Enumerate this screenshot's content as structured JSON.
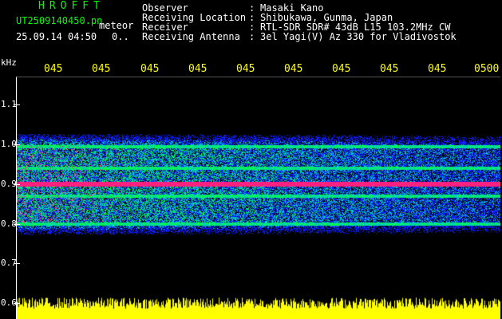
{
  "header": {
    "app_title": "HROFFT",
    "file_name": "UT2509140450.pn",
    "file_suffix": "meteor",
    "datetime": "25.09.14 04:50",
    "seq": "0..",
    "info": [
      {
        "label": "Observer",
        "value": "Masaki Kano"
      },
      {
        "label": "Receiving Location",
        "value": "Shibukawa, Gunma, Japan"
      },
      {
        "label": "Receiver",
        "value": "RTL-SDR SDR# 43dB L15 103.2MHz CW"
      },
      {
        "label": "Receiving Antenna",
        "value": "3el Yagi(V) Az 330 for Vladivostok"
      }
    ],
    "separator": ":"
  },
  "axis": {
    "unit": "kHz",
    "freq_ticks": [
      "1.1",
      "1.0",
      "0.9",
      "0.8",
      "0.7",
      "0.6"
    ],
    "time_ticks": [
      "045",
      "045",
      "045",
      "045",
      "045",
      "045",
      "045",
      "045",
      "045",
      "0500"
    ]
  },
  "spectrogram": {
    "freq_range_khz": [
      0.6,
      1.12
    ],
    "band_range_khz": [
      0.765,
      1.035
    ],
    "strong_lines_khz": [
      0.9
    ],
    "weak_lines_khz": [
      0.995,
      0.8,
      0.87,
      0.94
    ],
    "colors": {
      "background": "#000000",
      "low": "#1020ff",
      "mid": "#00c8c8",
      "high": "#00ff40",
      "peak": "#ff2080",
      "signal_bar": "#ffff00"
    }
  }
}
